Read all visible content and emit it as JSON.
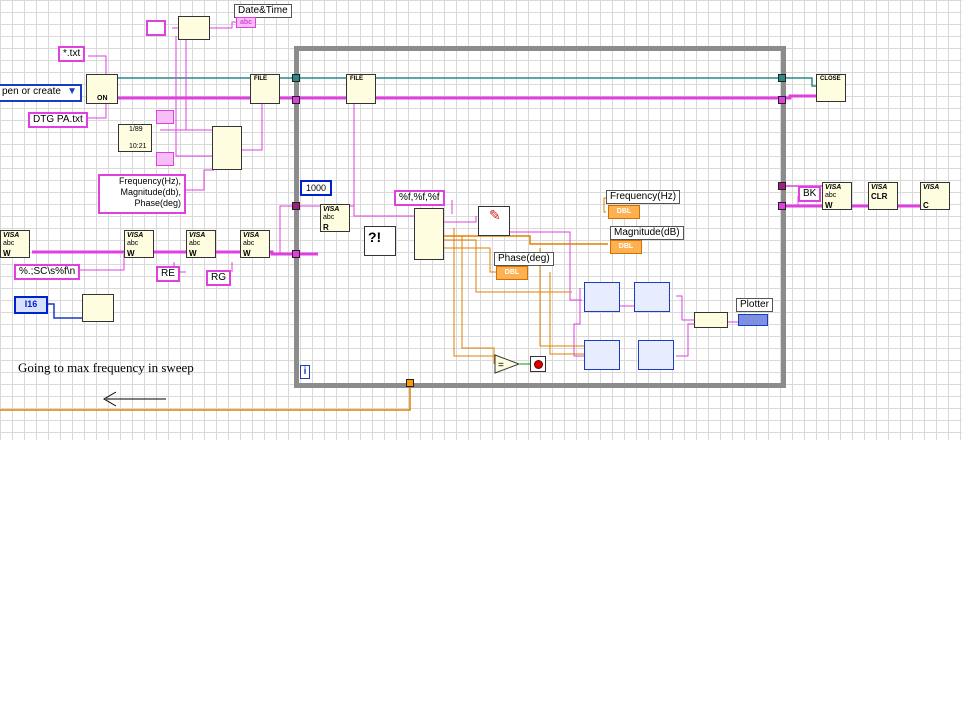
{
  "constants": {
    "txt_pattern": "*.txt",
    "open_mode": "pen or create",
    "filename": "DTG PA.txt",
    "column_header": "Frequency(Hz),\nMagnitude(db),\nPhase(deg)",
    "format_string": "%.;SC\\s%f\\n",
    "type_i16": "I16",
    "re_cmd": "RE",
    "rg_cmd": "RG",
    "timeout": "1000",
    "scan_format": "%f,%f,%f",
    "bk_cmd": "BK"
  },
  "indicators": {
    "datetime": "Date&Time",
    "frequency": "Frequency(Hz)",
    "magnitude": "Magnitude(dB)",
    "phase": "Phase(deg)",
    "plotter": "Plotter",
    "dbl": "DBL",
    "abc": "abc"
  },
  "nodes": {
    "visa": "VISA",
    "abc": "abc",
    "w": "W",
    "r": "R",
    "clr": "CLR",
    "c": "C",
    "file": "FILE",
    "close": "CLOSE",
    "on": "ON",
    "n189": "1/89",
    "n1021": "10:21",
    "loop_i": "i"
  },
  "comment": {
    "text": "Going to max frequency in sweep",
    "arrow": "←"
  }
}
